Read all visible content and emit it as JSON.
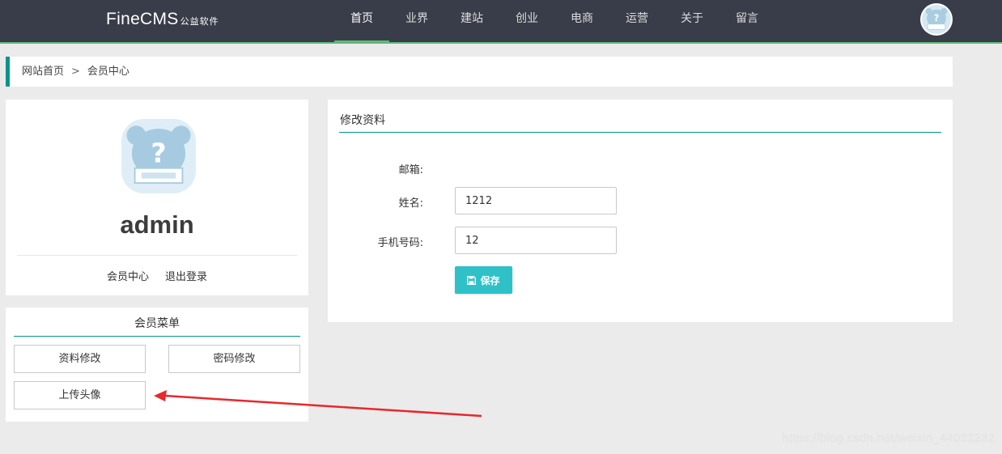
{
  "header": {
    "logo_main": "FineCMS",
    "logo_sub": "公益软件",
    "nav": [
      {
        "label": "首页",
        "active": true
      },
      {
        "label": "业界",
        "active": false
      },
      {
        "label": "建站",
        "active": false
      },
      {
        "label": "创业",
        "active": false
      },
      {
        "label": "电商",
        "active": false
      },
      {
        "label": "运营",
        "active": false
      },
      {
        "label": "关于",
        "active": false
      },
      {
        "label": "留言",
        "active": false
      }
    ],
    "avatar_icon": "default-avatar-icon"
  },
  "breadcrumb": {
    "home": "网站首页",
    "separator": ">",
    "current": "会员中心"
  },
  "profile": {
    "username": "admin",
    "links": {
      "member_center": "会员中心",
      "logout": "退出登录"
    }
  },
  "member_menu": {
    "title": "会员菜单",
    "items": [
      "资料修改",
      "密码修改",
      "上传头像"
    ]
  },
  "edit_panel": {
    "title": "修改资料",
    "email_label": "邮箱:",
    "name_label": "姓名:",
    "name_value": "1212",
    "phone_label": "手机号码:",
    "phone_value": "12",
    "save_label": "保存"
  },
  "watermark": "https://blog.csdn.net/weixin_44032232",
  "colors": {
    "nav_bg": "#393d49",
    "accent_green": "#5fb878",
    "teal": "#009688",
    "save_button": "#2fc1c8",
    "arrow": "#e8282b"
  }
}
